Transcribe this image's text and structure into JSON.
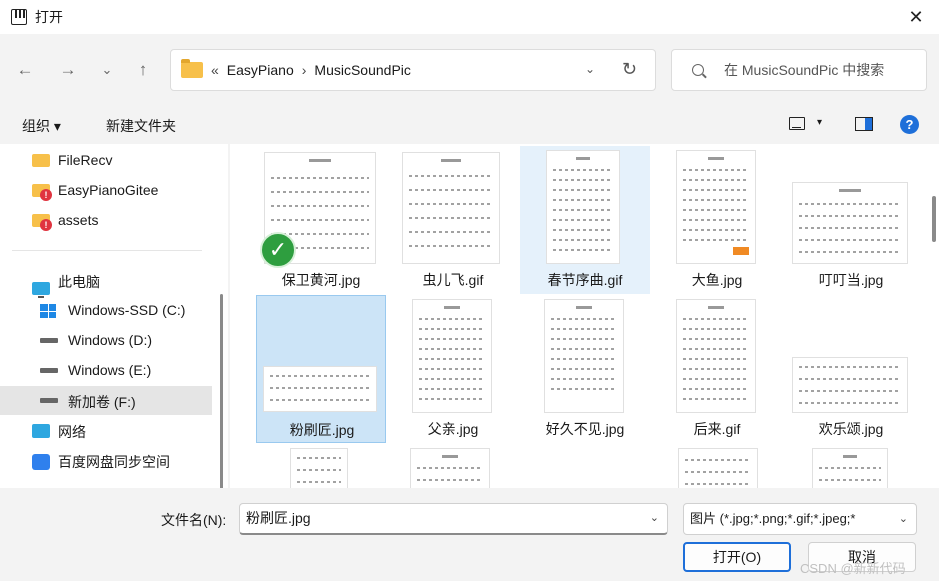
{
  "window": {
    "title": "打开",
    "close": "✕"
  },
  "nav": {
    "back": "←",
    "forward": "→",
    "recent": "⌄",
    "up": "↑",
    "breadcrumb_prefix": "«",
    "breadcrumbs": [
      "EasyPiano",
      "MusicSoundPic"
    ],
    "separator": "›",
    "dropdown": "⌄",
    "refresh": "↻",
    "search_placeholder": "在 MusicSoundPic 中搜索"
  },
  "toolbar": {
    "organize": "组织 ▾",
    "new_folder": "新建文件夹",
    "view_caret": "▾",
    "help": "?"
  },
  "sidebar": {
    "items": [
      {
        "label": "FileRecv",
        "icon": "folder-icon"
      },
      {
        "label": "EasyPianoGitee",
        "icon": "folder-warning-icon"
      },
      {
        "label": "assets",
        "icon": "folder-warning-icon"
      },
      {
        "label": "此电脑",
        "icon": "computer-icon"
      },
      {
        "label": "Windows-SSD (C:)",
        "icon": "windows-drive-icon"
      },
      {
        "label": "Windows (D:)",
        "icon": "drive-icon"
      },
      {
        "label": "Windows (E:)",
        "icon": "drive-icon"
      },
      {
        "label": "新加卷 (F:)",
        "icon": "drive-icon",
        "selected": true
      },
      {
        "label": "网络",
        "icon": "network-icon"
      },
      {
        "label": "百度网盘同步空间",
        "icon": "baidu-cloud-icon"
      }
    ]
  },
  "files": [
    {
      "name": "保卫黄河.jpg",
      "synced": true
    },
    {
      "name": "虫儿飞.gif"
    },
    {
      "name": "春节序曲.gif",
      "state": "hover"
    },
    {
      "name": "大鱼.jpg"
    },
    {
      "name": "叮叮当.jpg"
    },
    {
      "name": "粉刷匠.jpg",
      "state": "selected"
    },
    {
      "name": "父亲.jpg"
    },
    {
      "name": "好久不见.jpg"
    },
    {
      "name": "后来.gif"
    },
    {
      "name": "欢乐颂.jpg"
    }
  ],
  "bottom": {
    "filename_label": "文件名(N):",
    "filename_value": "粉刷匠.jpg",
    "filter_value": "图片 (*.jpg;*.png;*.gif;*.jpeg;*",
    "open_button": "打开(O)",
    "cancel_button": "取消",
    "watermark": "CSDN @新新代码",
    "caret": "⌄"
  },
  "colors": {
    "accent": "#1e6fd9",
    "selected_bg": "#cce4f7",
    "hover_bg": "#e5f1fb",
    "folder": "#f7c04a"
  }
}
